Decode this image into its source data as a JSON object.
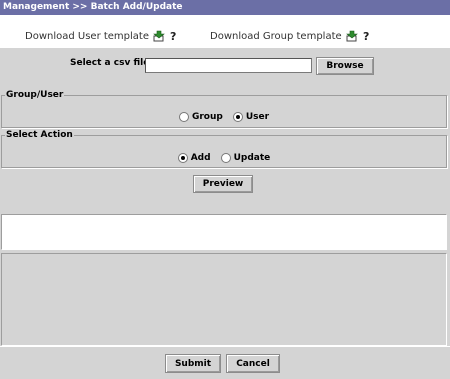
{
  "title_bar": {
    "text": "Management >> Batch Add/Update"
  },
  "downloads": {
    "user_template": "Download User template",
    "group_template": "Download Group template",
    "icons": [
      "download-arrow-icon",
      "help-question-icon"
    ]
  },
  "file_select": {
    "label": "Select a csv file:",
    "value": "",
    "browse_label": "Browse"
  },
  "group_user": {
    "legend": "Group/User",
    "options": [
      {
        "label": "Group",
        "checked": false
      },
      {
        "label": "User",
        "checked": true
      }
    ]
  },
  "select_action": {
    "legend": "Select Action",
    "options": [
      {
        "label": "Add",
        "checked": true
      },
      {
        "label": "Update",
        "checked": false
      }
    ]
  },
  "preview_label": "Preview",
  "footer": {
    "submit_label": "Submit",
    "cancel_label": "Cancel"
  },
  "colors": {
    "title_bar": "#6b6fa6",
    "panel": "#d4d4d4",
    "download_icon": "#2e8b2e"
  }
}
